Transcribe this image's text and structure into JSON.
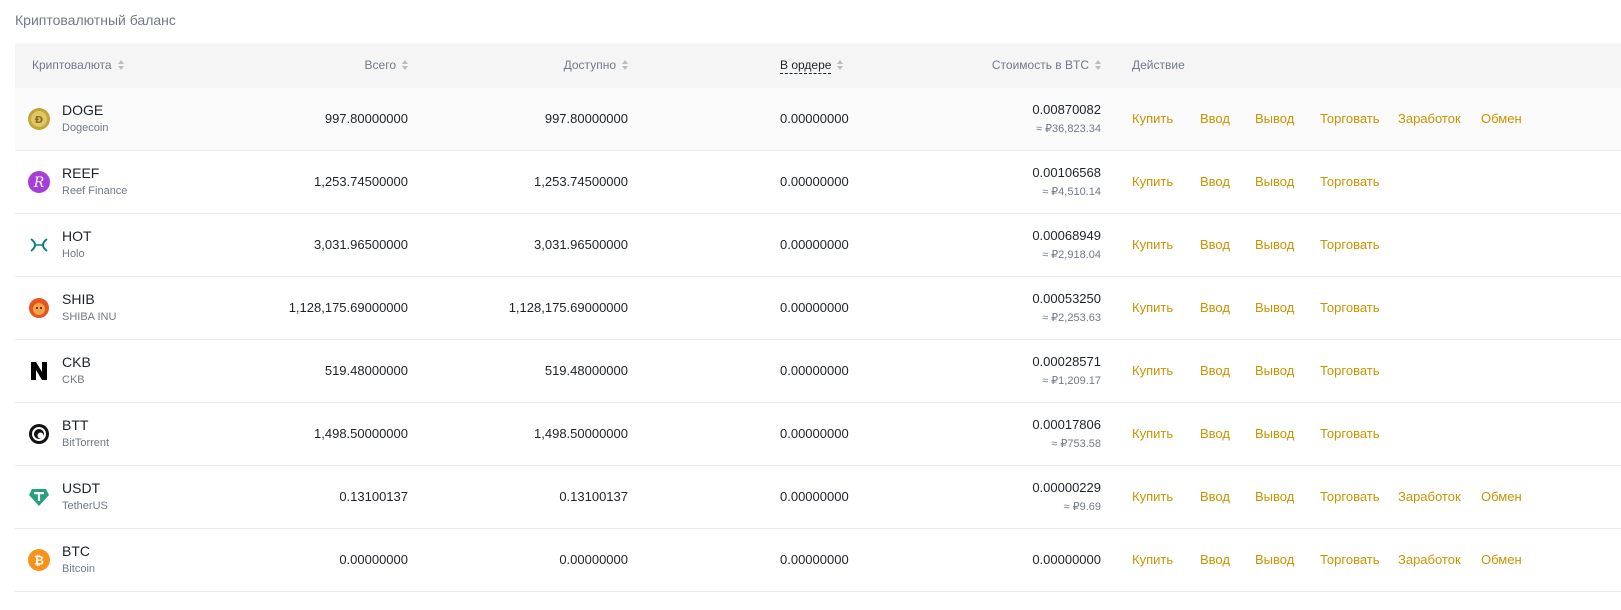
{
  "section_title": "Криптовалютный баланс",
  "columns": {
    "coin": "Криптовалюта",
    "total": "Всего",
    "available": "Доступно",
    "in_order": "В ордере",
    "btc_value": "Стоимость в BTC",
    "action": "Действие"
  },
  "actions": {
    "buy": "Купить",
    "deposit": "Ввод",
    "withdraw": "Вывод",
    "trade": "Торговать",
    "earn": "Заработок",
    "convert": "Обмен"
  },
  "rows": [
    {
      "symbol": "DOGE",
      "name": "Dogecoin",
      "icon": "doge-icon",
      "color": "#c2a633",
      "total": "997.80000000",
      "available": "997.80000000",
      "in_order": "0.00000000",
      "btc": "0.00870082",
      "fiat": "≈ ₽36,823.34",
      "earn": true
    },
    {
      "symbol": "REEF",
      "name": "Reef Finance",
      "icon": "reef-icon",
      "color": "#a93dd8",
      "total": "1,253.74500000",
      "available": "1,253.74500000",
      "in_order": "0.00000000",
      "btc": "0.00106568",
      "fiat": "≈ ₽4,510.14",
      "earn": false
    },
    {
      "symbol": "HOT",
      "name": "Holo",
      "icon": "holo-icon",
      "color": "#0b7d8a",
      "total": "3,031.96500000",
      "available": "3,031.96500000",
      "in_order": "0.00000000",
      "btc": "0.00068949",
      "fiat": "≈ ₽2,918.04",
      "earn": false
    },
    {
      "symbol": "SHIB",
      "name": "SHIBA INU",
      "icon": "shib-icon",
      "color": "#e4561b",
      "total": "1,128,175.69000000",
      "available": "1,128,175.69000000",
      "in_order": "0.00000000",
      "btc": "0.00053250",
      "fiat": "≈ ₽2,253.63",
      "earn": false
    },
    {
      "symbol": "CKB",
      "name": "CKB",
      "icon": "ckb-icon",
      "color": "#000000",
      "total": "519.48000000",
      "available": "519.48000000",
      "in_order": "0.00000000",
      "btc": "0.00028571",
      "fiat": "≈ ₽1,209.17",
      "earn": false
    },
    {
      "symbol": "BTT",
      "name": "BitTorrent",
      "icon": "btt-icon",
      "color": "#111111",
      "total": "1,498.50000000",
      "available": "1,498.50000000",
      "in_order": "0.00000000",
      "btc": "0.00017806",
      "fiat": "≈ ₽753.58",
      "earn": false
    },
    {
      "symbol": "USDT",
      "name": "TetherUS",
      "icon": "usdt-icon",
      "color": "#26a17b",
      "total": "0.13100137",
      "available": "0.13100137",
      "in_order": "0.00000000",
      "btc": "0.00000229",
      "fiat": "≈ ₽9.69",
      "earn": true
    },
    {
      "symbol": "BTC",
      "name": "Bitcoin",
      "icon": "btc-icon",
      "color": "#f7931a",
      "total": "0.00000000",
      "available": "0.00000000",
      "in_order": "0.00000000",
      "btc": "0.00000000",
      "fiat": "",
      "earn": true
    }
  ]
}
